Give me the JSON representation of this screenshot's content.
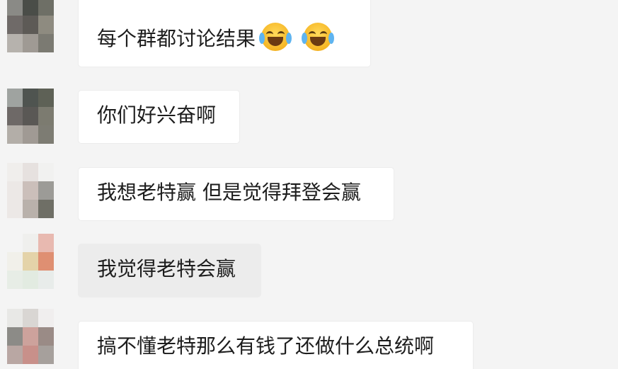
{
  "messages": [
    {
      "text": "每个群都讨论结果",
      "emojis": [
        "laugh-cry-emoji",
        "laugh-cry-emoji"
      ],
      "avatar_colors": [
        "#8a8a86",
        "#4a4d48",
        "#6e6f66",
        "#f4f4f4",
        "#6f6a68",
        "#5d5a56",
        "#8e8b80",
        "#f4f4f4",
        "#b6b2ad",
        "#9f9a94",
        "#7b7a72",
        "#f4f4f4"
      ]
    },
    {
      "text": "你们好兴奋啊",
      "avatar_colors": [
        "#9fa3a0",
        "#4f5450",
        "#5e6156",
        "#f4f4f4",
        "#6e6967",
        "#5a5855",
        "#7c7b70",
        "#f4f4f4",
        "#b3aea8",
        "#a09a94",
        "#7d7c73",
        "#f4f4f4"
      ]
    },
    {
      "text": "我想老特赢 但是觉得拜登会赢",
      "avatar_colors": [
        "#f0eeec",
        "#e6e1df",
        "#f1f1f0",
        "#f4f4f4",
        "#ece8e6",
        "#cbbfba",
        "#9c9b97",
        "#f4f4f4",
        "#ece8e6",
        "#b9b1ab",
        "#6f6f66",
        "#f4f4f4"
      ]
    },
    {
      "text": "我觉得老特会赢",
      "grey": true,
      "avatar_colors": [
        "#f4f4f4",
        "#efefed",
        "#e8b9b0",
        "#f4f4f4",
        "#f1f0ea",
        "#e4d3a9",
        "#df8f72",
        "#f4f4f4",
        "#e7ede6",
        "#e2ebe1",
        "#e8ecea",
        "#f4f4f4"
      ]
    },
    {
      "text": "搞不懂老特那么有钱了还做什么总统啊",
      "avatar_colors": [
        "#e8e8e6",
        "#d9d6d3",
        "#f0eeee",
        "#f4f4f4",
        "#8c8b87",
        "#cda29c",
        "#9a8b86",
        "#f4f4f4",
        "#b9a7a3",
        "#c8908a",
        "#a6a09c",
        "#f4f4f4"
      ]
    }
  ]
}
